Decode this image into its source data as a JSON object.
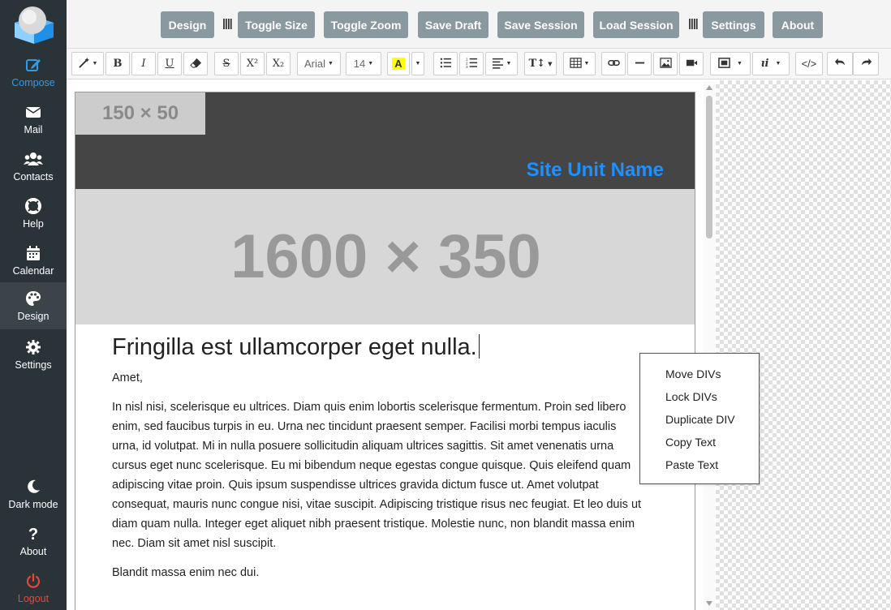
{
  "sidebar": {
    "items": [
      {
        "label": "Compose",
        "icon": "compose-icon"
      },
      {
        "label": "Mail",
        "icon": "mail-icon"
      },
      {
        "label": "Contacts",
        "icon": "contacts-icon"
      },
      {
        "label": "Help",
        "icon": "help-lifebuoy-icon"
      },
      {
        "label": "Calendar",
        "icon": "calendar-icon"
      },
      {
        "label": "Design",
        "icon": "palette-icon"
      },
      {
        "label": "Settings",
        "icon": "gear-icon"
      }
    ],
    "bottom": [
      {
        "label": "Dark mode",
        "icon": "moon-icon"
      },
      {
        "label": "About",
        "icon": "question-icon"
      },
      {
        "label": "Logout",
        "icon": "power-icon"
      }
    ]
  },
  "topbar": {
    "design": "Design",
    "toggle_size": "Toggle Size",
    "toggle_zoom": "Toggle Zoom",
    "save_draft": "Save Draft",
    "save_session": "Save Session",
    "load_session": "Load Session",
    "settings": "Settings",
    "about": "About",
    "separator": "||||"
  },
  "toolbar": {
    "font_family": "Arial",
    "font_size": "14",
    "bold": "B",
    "italic": "I",
    "underline": "U",
    "strike": "S",
    "superscript": "X²",
    "subscript": "X₂",
    "highlight": "A",
    "font_size_tool": "T↕",
    "code": "</>"
  },
  "document": {
    "logo_placeholder": "150 × 50",
    "site_name": "Site Unit Name",
    "hero_placeholder": "1600 × 350",
    "heading": "Fringilla est ullamcorper eget nulla.",
    "subheading": "Amet,",
    "paragraph1": "In nisl nisi, scelerisque eu ultrices. Diam quis enim lobortis scelerisque fermentum. Proin sed libero enim, sed faucibus turpis in eu. Urna nec tincidunt praesent semper. Facilisi morbi tempus iaculis urna, id volutpat. Mi in nulla posuere sollicitudin aliquam ultrices sagittis. Sit amet venenatis urna cursus eget nunc scelerisque. Eu mi bibendum neque egestas congue quisque. Quis eleifend quam adipiscing vitae proin. Quis ipsum suspendisse ultrices gravida dictum fusce ut. Amet volutpat consequat, mauris nunc congue nisi, vitae suscipit. Adipiscing tristique risus nec feugiat. Et leo duis ut diam quam nulla. Integer eget aliquet nibh praesent tristique. Molestie nunc, non blandit massa enim nec. Diam sit amet nisl suscipit.",
    "paragraph2": "Blandit massa enim nec dui."
  },
  "context_menu": {
    "items": [
      "Move DIVs",
      "Lock DIVs",
      "Duplicate DIV",
      "Copy Text",
      "Paste Text"
    ]
  },
  "colors": {
    "sidebar_bg": "#2a3338",
    "accent_blue": "#2f9bea",
    "logout_red": "#e8453c",
    "top_button": "#8a989f",
    "site_name": "#1e90ff"
  }
}
